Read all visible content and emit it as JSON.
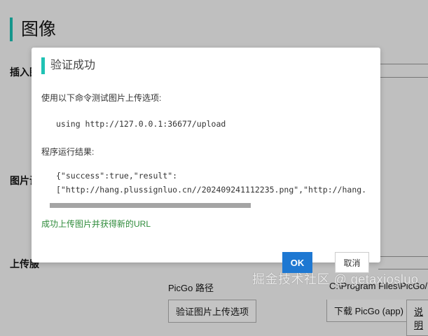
{
  "page": {
    "title": "图像",
    "labels": [
      "插入图",
      "图片设",
      "上传服"
    ],
    "picgo_path_label": "PicGo 路径",
    "picgo_path_value": "C:\\Program Files\\PicGo/Pi",
    "verify_button": "验证图片上传选项",
    "download_button": "下载 PicGo (app)",
    "help_button": "说明"
  },
  "watermark": "掘金技术社区 @ getaxiosluo",
  "dialog": {
    "title": "验证成功",
    "intro": "使用以下命令测试图片上传选项:",
    "command": "using http://127.0.0.1:36677/upload",
    "result_label": "程序运行结果:",
    "result_line1": "{\"success\":true,\"result\":",
    "result_line2": "[\"http://hang.plussignluo.cn//202409241112235.png\",\"http://hang.",
    "success_message": "成功上传图片并获得新的URL",
    "ok": "OK",
    "cancel": "取消"
  },
  "colors": {
    "accent": "#16968c",
    "ok": "#1e78d2",
    "success": "#2e8b3a"
  }
}
